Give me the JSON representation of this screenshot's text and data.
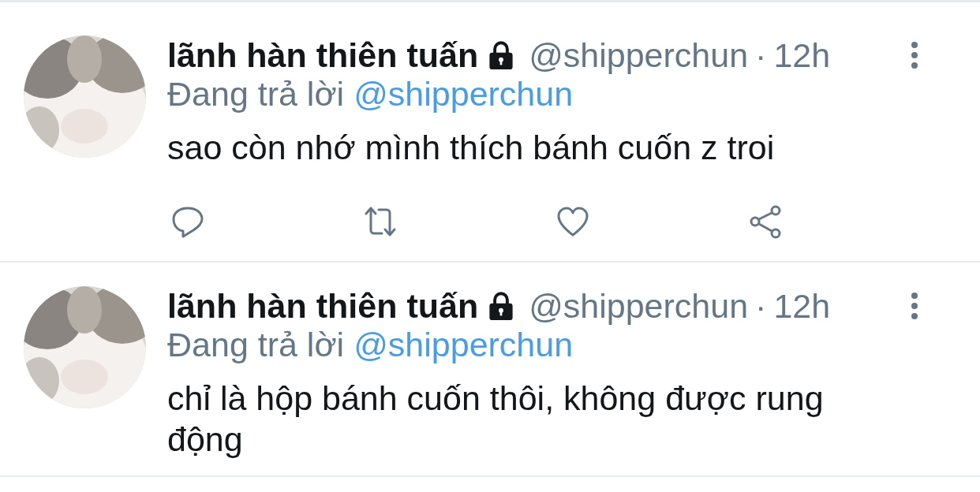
{
  "tweets": [
    {
      "author": {
        "name": "lãnh hàn thiên tuấn",
        "protected": true,
        "handle": "@shipperchun"
      },
      "separator": "·",
      "time": "12h",
      "replying_label": "Đang trả lời",
      "reply_to": "@shipperchun",
      "text": "sao còn nhớ mình thích bánh cuốn z troi",
      "actions_visible": true
    },
    {
      "author": {
        "name": "lãnh hàn thiên tuấn",
        "protected": true,
        "handle": "@shipperchun"
      },
      "separator": "·",
      "time": "12h",
      "replying_label": "Đang trả lời",
      "reply_to": "@shipperchun",
      "text": "chỉ là hộp bánh cuốn thôi, không được rung động",
      "actions_visible": false
    }
  ]
}
